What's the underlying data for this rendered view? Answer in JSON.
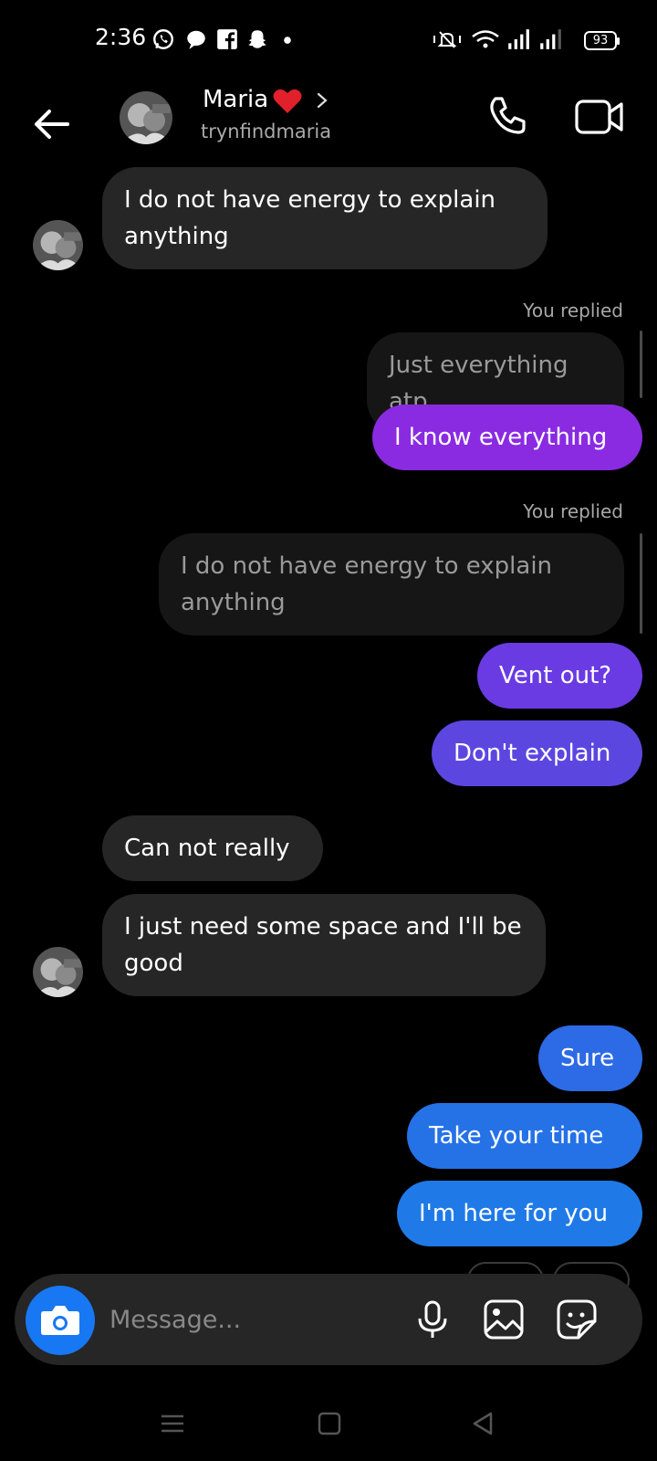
{
  "status_bar": {
    "time": "2:36",
    "battery": "93",
    "notification_icons": [
      "whatsapp-icon",
      "chat-bubble-icon",
      "facebook-icon",
      "snapchat-icon",
      "dot-icon"
    ],
    "system_icons": [
      "mute-vibrate-icon",
      "wifi-icon",
      "signal-icon",
      "signal-icon"
    ]
  },
  "header": {
    "name": "Maria",
    "username": "trynfindmaria",
    "icons": {
      "back": "arrow-left-icon",
      "name_emoji": "heart-icon",
      "chevron": "chevron-right-icon",
      "call": "phone-icon",
      "video": "video-camera-icon"
    }
  },
  "messages": {
    "m1": "I do not have energy to explain anything",
    "replied_label_1": "You replied",
    "reply_preview_1": "Just everything atp",
    "m2": "I know everything",
    "replied_label_2": "You replied",
    "reply_preview_2": "I do not have energy to explain anything",
    "m3": "Vent out?",
    "m4": "Don't explain",
    "m5": "Can not really",
    "m6": "I just need some space and I'll be good",
    "m7": "Sure",
    "m8": "Take your time",
    "m9": "I'm here for you"
  },
  "composer": {
    "placeholder": "Message...",
    "icons": [
      "camera-icon",
      "microphone-icon",
      "gallery-icon",
      "sticker-icon"
    ]
  },
  "colors": {
    "background": "#000000",
    "incoming_bubble": "#262626",
    "gradient_purple": "#8a2be2",
    "gradient_indigo": "#5b3fe0",
    "gradient_blue": "#1f7ae8",
    "camera_blue": "#1877f2"
  },
  "navigation": {
    "icons": [
      "menu-icon",
      "home-square-icon",
      "back-triangle-icon"
    ]
  }
}
